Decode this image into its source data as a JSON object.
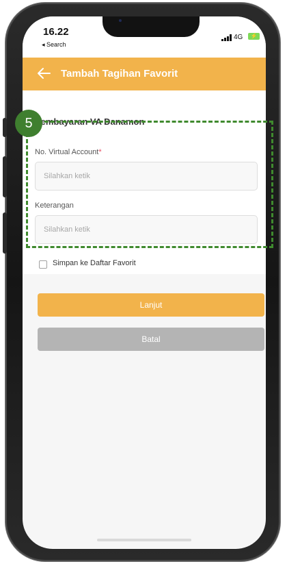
{
  "status_bar": {
    "time": "16.22",
    "back_to_app": "◂ Search",
    "network": "4G"
  },
  "header": {
    "title": "Tambah Tagihan Favorit"
  },
  "form": {
    "section_title": "Pembayaran VA Danamon",
    "fields": [
      {
        "label": "No. Virtual Account",
        "required_mark": "*",
        "value": "",
        "placeholder": "Silahkan ketik"
      },
      {
        "label": "Keterangan",
        "value": "",
        "placeholder": "Silahkan ketik"
      }
    ],
    "checkbox": {
      "label": "Simpan ke Daftar Favorit",
      "checked": false
    }
  },
  "buttons": {
    "primary": "Lanjut",
    "secondary": "Batal"
  },
  "annotation": {
    "step_number": "5"
  },
  "colors": {
    "accent": "#f2b34b",
    "secondary_button": "#b4b4b4",
    "annotation": "#3f8a2e",
    "required": "#e84a5f"
  },
  "icons": {
    "header_back": "arrow-left-icon",
    "signal": "signal-bars-icon",
    "battery": "battery-charging-icon"
  }
}
